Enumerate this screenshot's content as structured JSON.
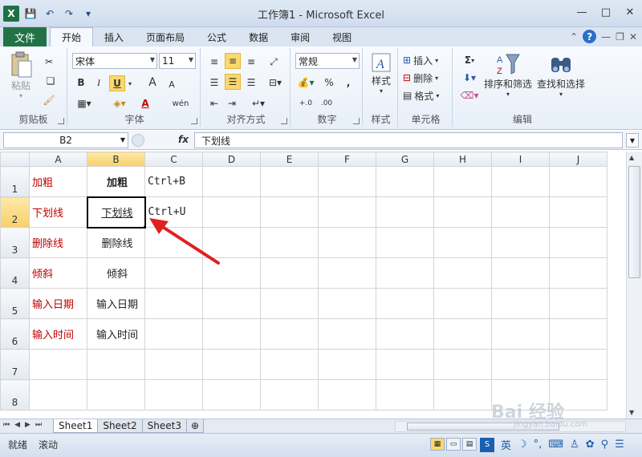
{
  "window": {
    "title": "工作簿1 - Microsoft Excel",
    "app_icon": "X",
    "controls": [
      "—",
      "□",
      "✕"
    ]
  },
  "quick_access": {
    "save": "💾",
    "undo": "↶",
    "redo": "↷",
    "customize": "▾"
  },
  "ribbon_tabs": {
    "file": "文件",
    "items": [
      "开始",
      "插入",
      "页面布局",
      "公式",
      "数据",
      "审阅",
      "视图"
    ],
    "active": "开始",
    "help": "?"
  },
  "ribbon": {
    "clipboard": {
      "label": "剪贴板",
      "paste": "粘贴"
    },
    "font": {
      "label": "字体",
      "family": "宋体",
      "size": "11",
      "bold": "B",
      "italic": "I",
      "underline": "U",
      "grow": "A",
      "shrink": "A",
      "font_color": "A",
      "phonetic": "wén"
    },
    "alignment": {
      "label": "对齐方式"
    },
    "number": {
      "label": "数字",
      "format": "常规",
      "percent": "%",
      "comma": ","
    },
    "styles": {
      "label": "样式",
      "button": "样式"
    },
    "cells": {
      "label": "单元格",
      "insert": "插入",
      "delete": "删除",
      "format": "格式"
    },
    "editing": {
      "label": "编辑",
      "sum": "Σ",
      "sort_filter": "排序和筛选",
      "find_select": "查找和选择"
    }
  },
  "formula_bar": {
    "name_box": "B2",
    "fx": "fx",
    "content": "下划线"
  },
  "sheet": {
    "columns": [
      "A",
      "B",
      "C",
      "D",
      "E",
      "F",
      "G",
      "H",
      "I",
      "J"
    ],
    "rows": [
      "1",
      "2",
      "3",
      "4",
      "5",
      "6",
      "7",
      "8"
    ],
    "cells": {
      "A1": "加粗",
      "B1": "加粗",
      "C1": "Ctrl+B",
      "A2": "下划线",
      "B2": "下划线",
      "C2": "Ctrl+U",
      "A3": "删除线",
      "B3": "删除线",
      "A4": "倾斜",
      "B4": "倾斜",
      "A5": "输入日期",
      "B5": "输入日期",
      "A6": "输入时间",
      "B6": "输入时间"
    },
    "active_cell": "B2"
  },
  "sheet_tabs": [
    "Sheet1",
    "Sheet2",
    "Sheet3"
  ],
  "status": {
    "ready": "就绪",
    "scroll": "滚动"
  },
  "ime": {
    "logo": "S",
    "lang": "英"
  },
  "watermark": {
    "main": "Bai 经验",
    "sub": "jingyan.baidu.com"
  },
  "colors": {
    "excel_green": "#217346",
    "red_text": "#c00000",
    "highlight": "#fbd86e",
    "arrow_red": "#e02020"
  }
}
